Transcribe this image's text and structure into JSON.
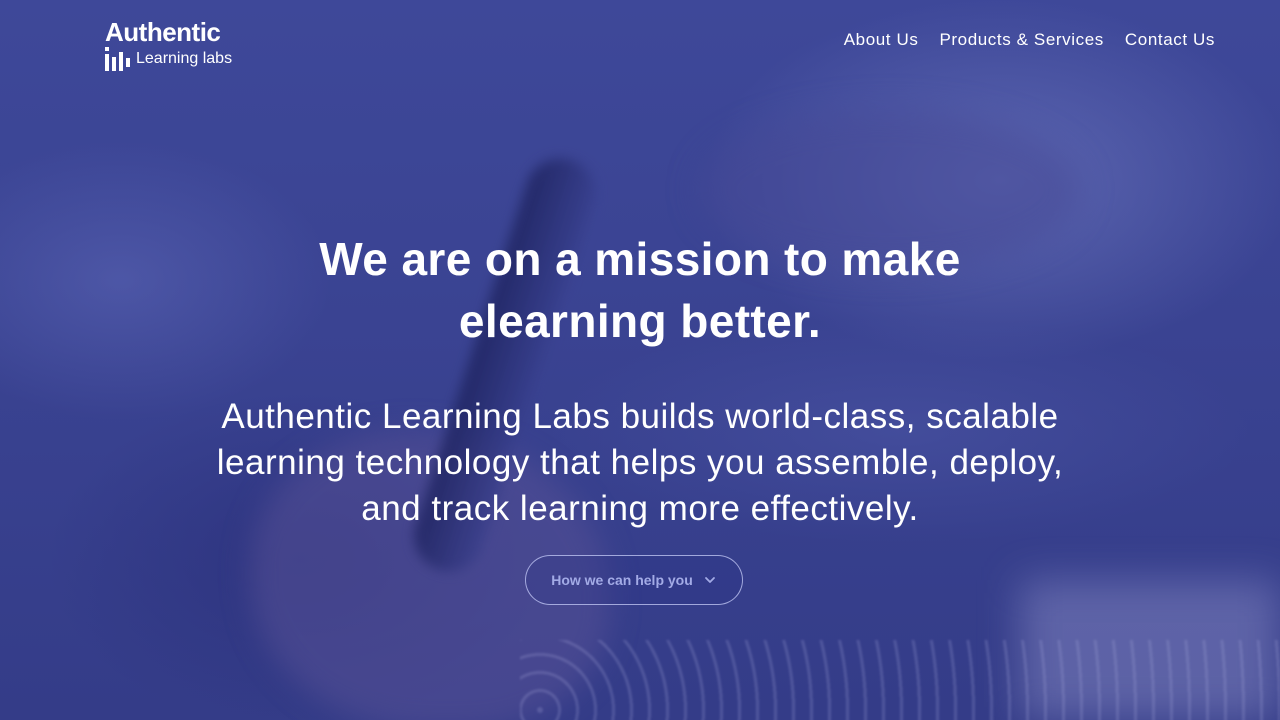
{
  "brand": {
    "title": "Authentic",
    "subtitle": "Learning labs"
  },
  "nav": {
    "items": [
      {
        "label": "About Us"
      },
      {
        "label": "Products & Services"
      },
      {
        "label": "Contact Us"
      }
    ]
  },
  "hero": {
    "headline_line1": "We are on a mission to make",
    "headline_line2": "elearning better.",
    "subhead_line1": "Authentic Learning Labs builds world-class, scalable",
    "subhead_line2": "learning technology that helps you assemble, deploy,",
    "subhead_line3": "and track learning more effectively.",
    "cta_label": "How we can help you",
    "cta_icon": "chevron-down-icon"
  },
  "colors": {
    "overlay": "#3c4594",
    "text": "#ffffff",
    "cta_text": "#a3abe6"
  }
}
